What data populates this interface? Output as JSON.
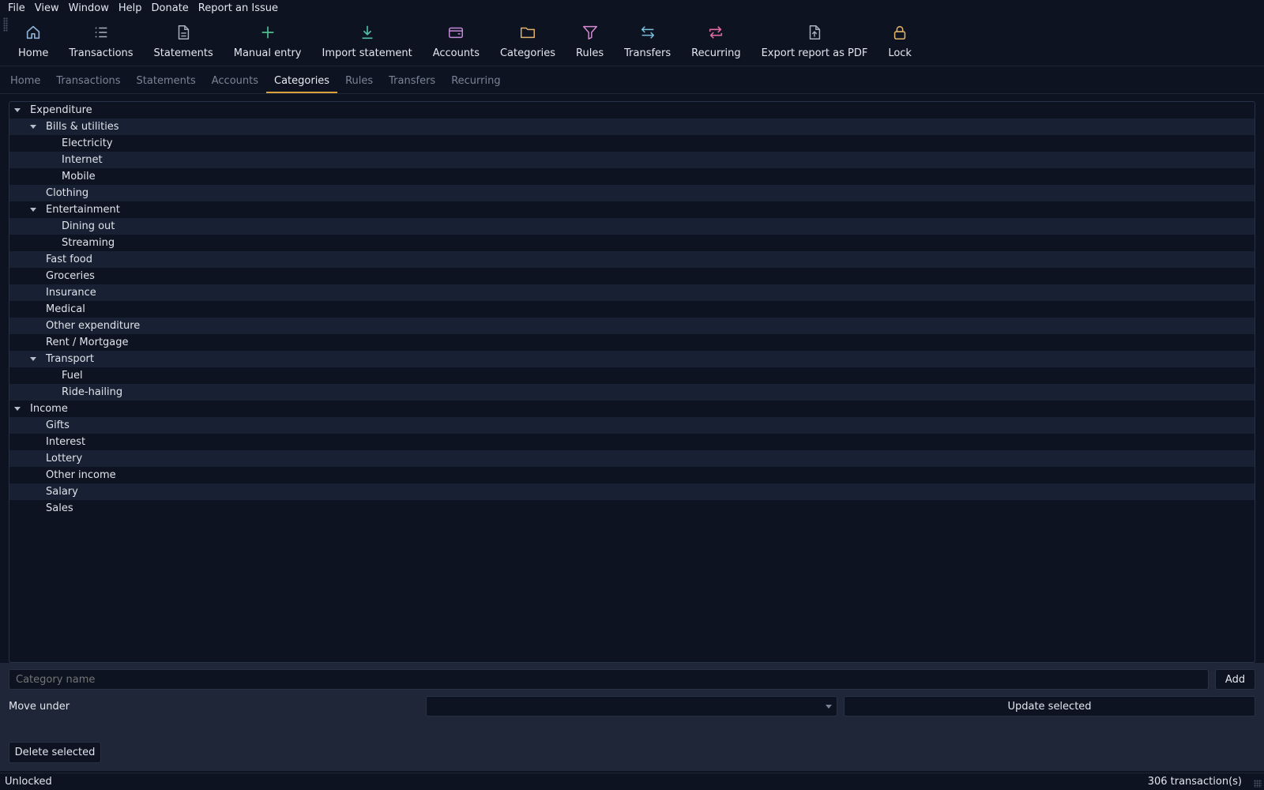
{
  "menu": [
    "File",
    "View",
    "Window",
    "Help",
    "Donate",
    "Report an Issue"
  ],
  "toolbar": [
    {
      "label": "Home",
      "icon": "home-icon",
      "color": "#8fb1d6"
    },
    {
      "label": "Transactions",
      "icon": "list-icon",
      "color": "#aab2c0"
    },
    {
      "label": "Statements",
      "icon": "document-icon",
      "color": "#aab2c0"
    },
    {
      "label": "Manual entry",
      "icon": "plus-icon",
      "color": "#4fbf8f"
    },
    {
      "label": "Import statement",
      "icon": "download-icon",
      "color": "#4fbfa6"
    },
    {
      "label": "Accounts",
      "icon": "wallet-icon",
      "color": "#c58ad8"
    },
    {
      "label": "Categories",
      "icon": "folder-icon",
      "color": "#e1b36a"
    },
    {
      "label": "Rules",
      "icon": "filter-icon",
      "color": "#d98ad2"
    },
    {
      "label": "Transfers",
      "icon": "transfer-icon",
      "color": "#79c1d8"
    },
    {
      "label": "Recurring",
      "icon": "repeat-icon",
      "color": "#e06aa0"
    },
    {
      "label": "Export report as PDF",
      "icon": "file-export-icon",
      "color": "#aab2c0"
    },
    {
      "label": "Lock",
      "icon": "lock-icon",
      "color": "#e1b36a"
    }
  ],
  "tabs": [
    {
      "label": "Home",
      "active": false
    },
    {
      "label": "Transactions",
      "active": false
    },
    {
      "label": "Statements",
      "active": false
    },
    {
      "label": "Accounts",
      "active": false
    },
    {
      "label": "Categories",
      "active": true
    },
    {
      "label": "Rules",
      "active": false
    },
    {
      "label": "Transfers",
      "active": false
    },
    {
      "label": "Recurring",
      "active": false
    }
  ],
  "tree": [
    {
      "label": "Expenditure",
      "level": 0,
      "expanded": true
    },
    {
      "label": "Bills & utilities",
      "level": 1,
      "expanded": true
    },
    {
      "label": "Electricity",
      "level": 2
    },
    {
      "label": "Internet",
      "level": 2
    },
    {
      "label": "Mobile",
      "level": 2
    },
    {
      "label": "Clothing",
      "level": 1
    },
    {
      "label": "Entertainment",
      "level": 1,
      "expanded": true
    },
    {
      "label": "Dining out",
      "level": 2
    },
    {
      "label": "Streaming",
      "level": 2
    },
    {
      "label": "Fast food",
      "level": 1
    },
    {
      "label": "Groceries",
      "level": 1
    },
    {
      "label": "Insurance",
      "level": 1
    },
    {
      "label": "Medical",
      "level": 1
    },
    {
      "label": "Other expenditure",
      "level": 1
    },
    {
      "label": "Rent / Mortgage",
      "level": 1
    },
    {
      "label": "Transport",
      "level": 1,
      "expanded": true
    },
    {
      "label": "Fuel",
      "level": 2
    },
    {
      "label": "Ride-hailing",
      "level": 2
    },
    {
      "label": "Income",
      "level": 0,
      "expanded": true
    },
    {
      "label": "Gifts",
      "level": 1
    },
    {
      "label": "Interest",
      "level": 1
    },
    {
      "label": "Lottery",
      "level": 1
    },
    {
      "label": "Other income",
      "level": 1
    },
    {
      "label": "Salary",
      "level": 1
    },
    {
      "label": "Sales",
      "level": 1
    }
  ],
  "form": {
    "name_placeholder": "Category name",
    "name_value": "",
    "add_label": "Add",
    "move_under_label": "Move under",
    "move_under_value": "",
    "update_label": "Update selected",
    "delete_label": "Delete selected"
  },
  "status": {
    "left": "Unlocked",
    "right": "306 transaction(s)"
  }
}
